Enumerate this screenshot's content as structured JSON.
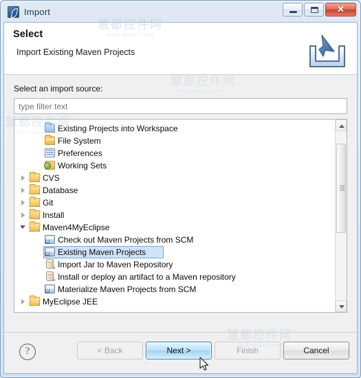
{
  "window": {
    "title": "Import",
    "icon": "import-wizard-icon",
    "controls": {
      "minimize": "minimize-button",
      "maximize": "maximize-button",
      "close_label": "✕"
    }
  },
  "banner": {
    "title": "Select",
    "subtitle": "Import Existing Maven Projects",
    "icon": "import-arrow-icon"
  },
  "content": {
    "source_label": "Select an import source:",
    "filter_placeholder": "type filter text",
    "filter_value": ""
  },
  "tree": {
    "items": [
      {
        "label": "Existing Projects into Workspace",
        "icon": "project-folder-icon",
        "level": 1,
        "twisty": "none",
        "selected": false
      },
      {
        "label": "File System",
        "icon": "folder-icon",
        "level": 1,
        "twisty": "none",
        "selected": false
      },
      {
        "label": "Preferences",
        "icon": "preferences-icon",
        "level": 1,
        "twisty": "none",
        "selected": false
      },
      {
        "label": "Working Sets",
        "icon": "working-sets-icon",
        "level": 1,
        "twisty": "none",
        "selected": false
      },
      {
        "label": "CVS",
        "icon": "folder-open-icon",
        "level": 0,
        "twisty": "closed",
        "selected": false
      },
      {
        "label": "Database",
        "icon": "folder-open-icon",
        "level": 0,
        "twisty": "closed",
        "selected": false
      },
      {
        "label": "Git",
        "icon": "folder-open-icon",
        "level": 0,
        "twisty": "closed",
        "selected": false
      },
      {
        "label": "Install",
        "icon": "folder-open-icon",
        "level": 0,
        "twisty": "closed",
        "selected": false
      },
      {
        "label": "Maven4MyEclipse",
        "icon": "folder-open-icon",
        "level": 0,
        "twisty": "open",
        "selected": false
      },
      {
        "label": "Check out Maven Projects from SCM",
        "icon": "maven-project-icon",
        "level": 1,
        "twisty": "none",
        "selected": false
      },
      {
        "label": "Existing Maven Projects",
        "icon": "maven-project-icon",
        "level": 1,
        "twisty": "none",
        "selected": true
      },
      {
        "label": "Import Jar to Maven Repository",
        "icon": "jar-icon",
        "level": 1,
        "twisty": "none",
        "selected": false
      },
      {
        "label": "Install or deploy an artifact to a Maven repository",
        "icon": "jar-icon",
        "level": 1,
        "twisty": "none",
        "selected": false
      },
      {
        "label": "Materialize Maven Projects from SCM",
        "icon": "maven-project-icon",
        "level": 1,
        "twisty": "none",
        "selected": false
      },
      {
        "label": "MyEclipse JEE",
        "icon": "folder-open-icon",
        "level": 0,
        "twisty": "closed",
        "selected": false
      }
    ]
  },
  "footer": {
    "help_label": "?",
    "back_label": "< Back",
    "next_label": "Next >",
    "finish_label": "Finish",
    "cancel_label": "Cancel"
  },
  "watermarks": {
    "cn": "慧都控件网",
    "url": "www.evget.com"
  },
  "colors": {
    "accent": "#3c7fb1",
    "selection_fill": "#cfe3f7",
    "selection_border": "#7aa7d4",
    "close_button": "#c83f2a",
    "folder": "#f0b84a",
    "dialog_bg": "#f0f0f0"
  }
}
